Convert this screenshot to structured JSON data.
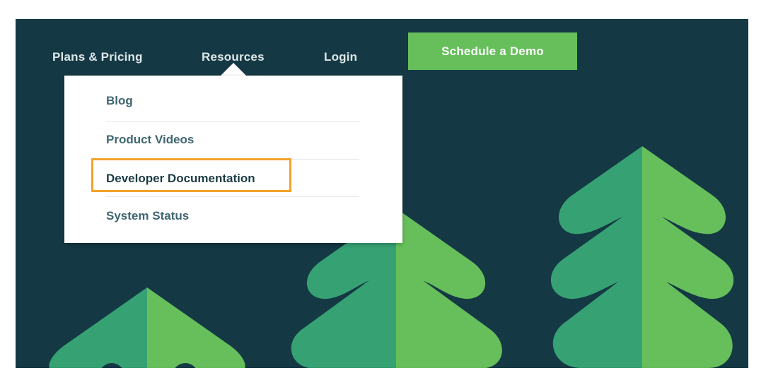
{
  "nav": {
    "plans_label": "Plans & Pricing",
    "resources_label": "Resources",
    "login_label": "Login",
    "cta_label": "Schedule a Demo"
  },
  "dropdown": {
    "items": [
      {
        "label": "Blog"
      },
      {
        "label": "Product Videos"
      },
      {
        "label": "Developer Documentation",
        "highlighted": true
      },
      {
        "label": "System Status"
      }
    ]
  },
  "colors": {
    "background": "#153944",
    "cta": "#67bf5c",
    "tree_light": "#67bf5c",
    "tree_dark": "#36a274",
    "highlight_outline": "#f2a32a",
    "menu_text": "#3f6670"
  },
  "icons": [
    "tree-illustration"
  ]
}
